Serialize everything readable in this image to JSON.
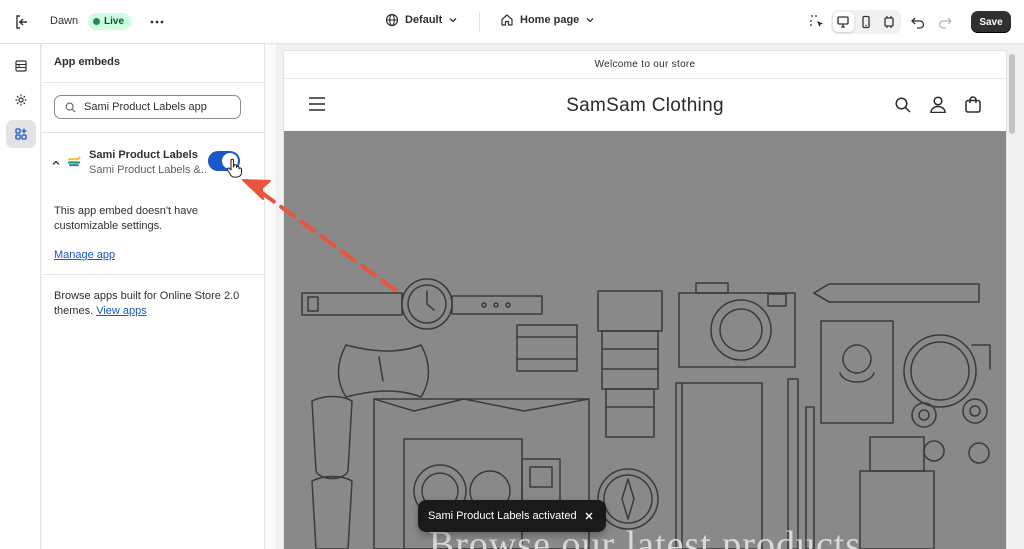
{
  "topbar": {
    "theme_name": "Dawn",
    "live_badge": "Live",
    "default_label": "Default",
    "page_label": "Home page",
    "save_label": "Save"
  },
  "panel": {
    "title": "App embeds",
    "search_value": "Sami Product Labels app",
    "embed": {
      "name": "Sami Product Labels",
      "subtitle": "Sami Product Labels &...",
      "enabled": true
    },
    "no_settings_text": "This app embed doesn't have customizable settings.",
    "manage_link": "Manage app",
    "browse_text": "Browse apps built for Online Store 2.0 themes.",
    "view_apps_link": "View apps"
  },
  "preview": {
    "announcement": "Welcome to our store",
    "brand": "SamSam Clothing",
    "hero_heading": "Browse our latest products"
  },
  "toast": {
    "message": "Sami Product Labels activated"
  },
  "colors": {
    "accent": "#1a57c8",
    "annotation_arrow": "#e8553d",
    "hero_bg": "#898989"
  }
}
